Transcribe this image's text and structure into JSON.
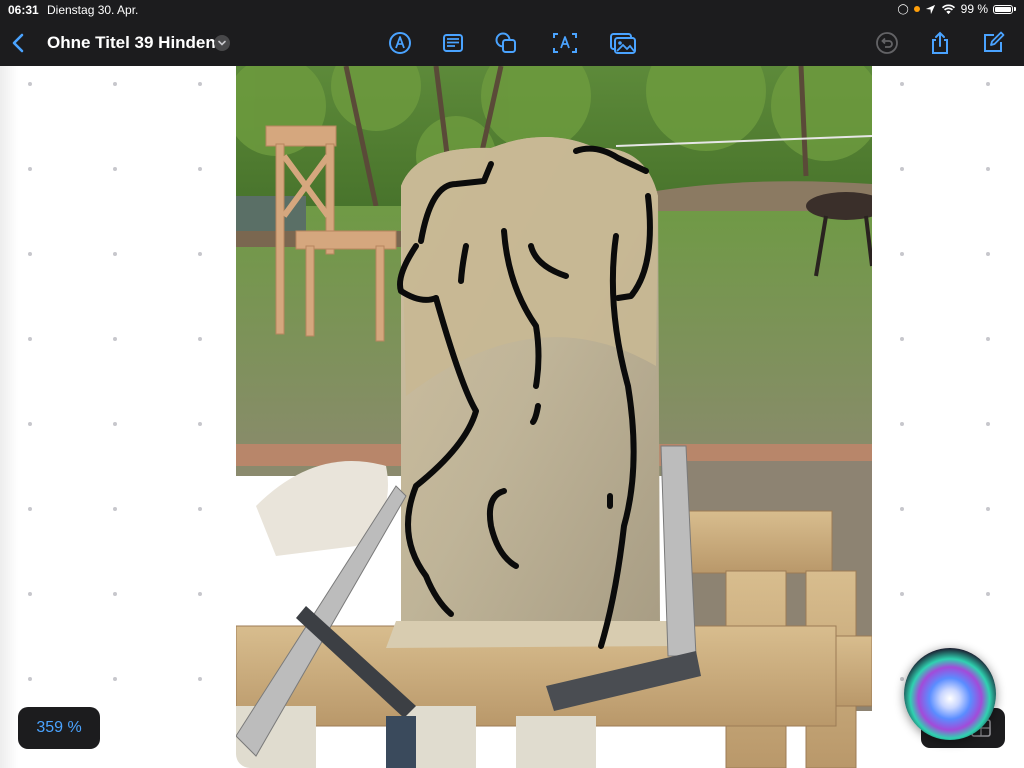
{
  "status": {
    "time": "06:31",
    "date": "Dienstag 30. Apr.",
    "battery": "99 %"
  },
  "toolbar": {
    "title": "Ohne Titel 39 Hinden",
    "icons": [
      "back-chevron-icon",
      "pen-icon",
      "textbox-icon",
      "shapes-icon",
      "text-icon",
      "media-icon",
      "undo-icon",
      "share-icon",
      "compose-icon"
    ]
  },
  "canvas": {
    "zoom": "359 %"
  },
  "colors": {
    "bar": "#1c1c1e",
    "accent": "#4aa3ff"
  }
}
